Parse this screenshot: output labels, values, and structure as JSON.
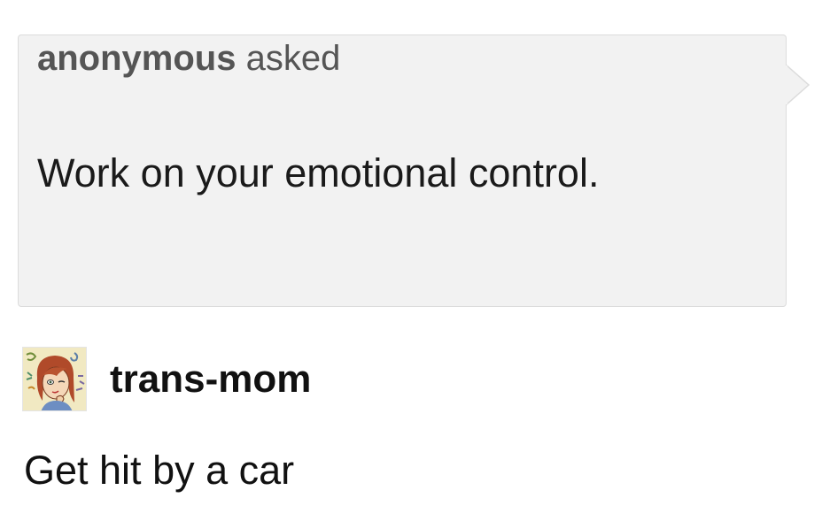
{
  "ask": {
    "asker": "anonymous",
    "verb": "asked",
    "question": "Work on your emotional control."
  },
  "answer": {
    "avatar_icon": "user-avatar-illustration",
    "username": "trans-mom",
    "reply": "Get hit by a car"
  },
  "colors": {
    "ask_background": "#f2f2f2",
    "ask_border": "#dcdcdc",
    "text": "#111111",
    "asker_text": "#555555"
  }
}
